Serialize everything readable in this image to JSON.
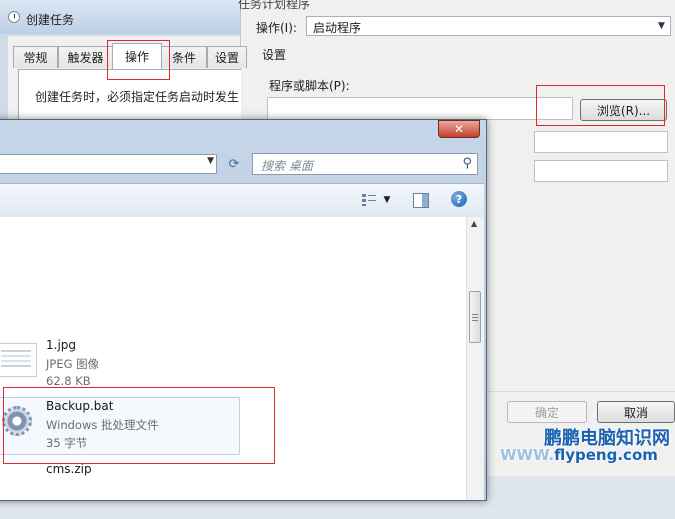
{
  "task_window": {
    "title": "创建任务",
    "behind_title": "任务计划程序",
    "tabs": [
      "常规",
      "触发器",
      "操作",
      "条件",
      "设置"
    ],
    "active_tab": "操作",
    "info_text": "创建任务时，必须指定任务启动时发生"
  },
  "action_dialog": {
    "action_label": "操作(I):",
    "action_value": "启动程序",
    "settings_label": "设置",
    "program_label": "程序或脚本(P):",
    "browse_button": "浏览(R)...",
    "ok_button": "确定",
    "cancel_button": "取消"
  },
  "file_dialog": {
    "close_glyph": "✕",
    "search_placeholder": "搜索 桌面",
    "files": [
      {
        "name": "1.jpg",
        "type": "JPEG 图像",
        "size": "62.8 KB",
        "icon": "image-icon"
      },
      {
        "name": "Backup.bat",
        "type": "Windows 批处理文件",
        "size": "35 字节",
        "icon": "batch-file-icon",
        "selected": true
      },
      {
        "name": "cms.zip",
        "type": "",
        "size": "",
        "icon": "zip-icon"
      }
    ]
  },
  "watermark": {
    "site_name": "鹏鹏电脑知识网",
    "url_prefix": "WWW.",
    "url_rest": "flypeng.com"
  },
  "colors": {
    "annotation": "#e0262e",
    "selection_bg": "#f5f9fd",
    "watermark": "#1b62b0"
  }
}
